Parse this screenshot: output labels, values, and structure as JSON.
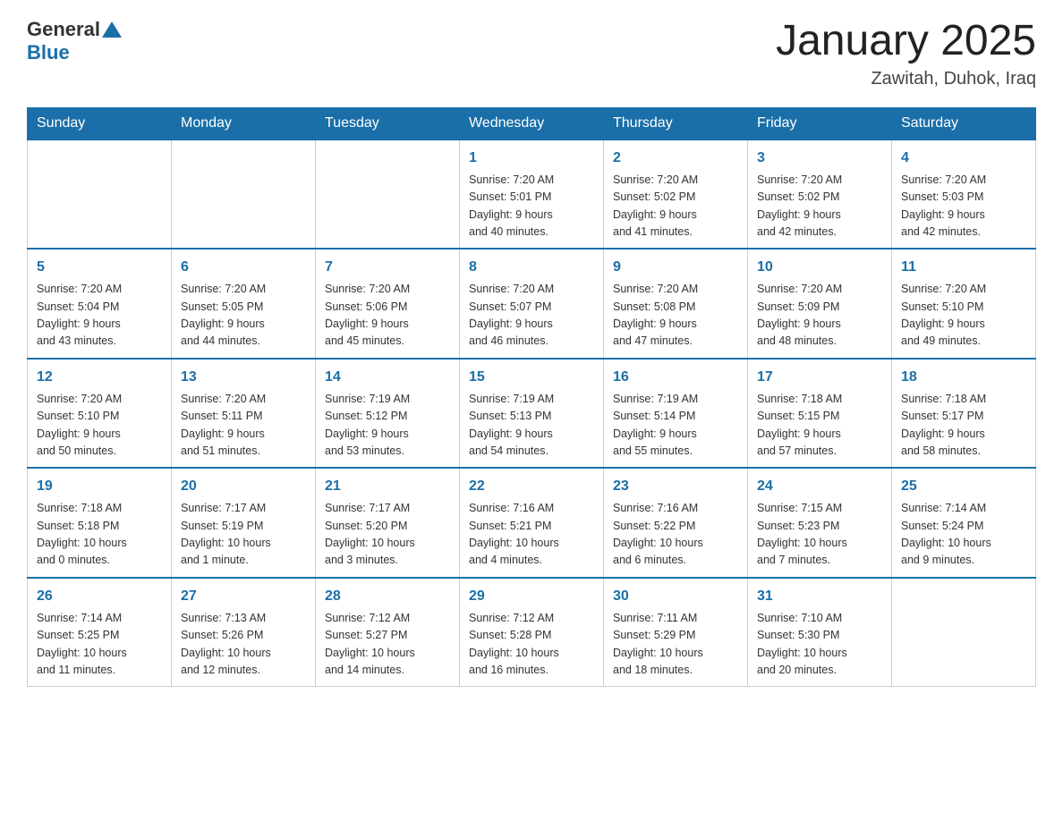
{
  "header": {
    "logo_general": "General",
    "logo_blue": "Blue",
    "month_title": "January 2025",
    "location": "Zawitah, Duhok, Iraq"
  },
  "days_of_week": [
    "Sunday",
    "Monday",
    "Tuesday",
    "Wednesday",
    "Thursday",
    "Friday",
    "Saturday"
  ],
  "weeks": [
    [
      {
        "day": "",
        "info": ""
      },
      {
        "day": "",
        "info": ""
      },
      {
        "day": "",
        "info": ""
      },
      {
        "day": "1",
        "info": "Sunrise: 7:20 AM\nSunset: 5:01 PM\nDaylight: 9 hours\nand 40 minutes."
      },
      {
        "day": "2",
        "info": "Sunrise: 7:20 AM\nSunset: 5:02 PM\nDaylight: 9 hours\nand 41 minutes."
      },
      {
        "day": "3",
        "info": "Sunrise: 7:20 AM\nSunset: 5:02 PM\nDaylight: 9 hours\nand 42 minutes."
      },
      {
        "day": "4",
        "info": "Sunrise: 7:20 AM\nSunset: 5:03 PM\nDaylight: 9 hours\nand 42 minutes."
      }
    ],
    [
      {
        "day": "5",
        "info": "Sunrise: 7:20 AM\nSunset: 5:04 PM\nDaylight: 9 hours\nand 43 minutes."
      },
      {
        "day": "6",
        "info": "Sunrise: 7:20 AM\nSunset: 5:05 PM\nDaylight: 9 hours\nand 44 minutes."
      },
      {
        "day": "7",
        "info": "Sunrise: 7:20 AM\nSunset: 5:06 PM\nDaylight: 9 hours\nand 45 minutes."
      },
      {
        "day": "8",
        "info": "Sunrise: 7:20 AM\nSunset: 5:07 PM\nDaylight: 9 hours\nand 46 minutes."
      },
      {
        "day": "9",
        "info": "Sunrise: 7:20 AM\nSunset: 5:08 PM\nDaylight: 9 hours\nand 47 minutes."
      },
      {
        "day": "10",
        "info": "Sunrise: 7:20 AM\nSunset: 5:09 PM\nDaylight: 9 hours\nand 48 minutes."
      },
      {
        "day": "11",
        "info": "Sunrise: 7:20 AM\nSunset: 5:10 PM\nDaylight: 9 hours\nand 49 minutes."
      }
    ],
    [
      {
        "day": "12",
        "info": "Sunrise: 7:20 AM\nSunset: 5:10 PM\nDaylight: 9 hours\nand 50 minutes."
      },
      {
        "day": "13",
        "info": "Sunrise: 7:20 AM\nSunset: 5:11 PM\nDaylight: 9 hours\nand 51 minutes."
      },
      {
        "day": "14",
        "info": "Sunrise: 7:19 AM\nSunset: 5:12 PM\nDaylight: 9 hours\nand 53 minutes."
      },
      {
        "day": "15",
        "info": "Sunrise: 7:19 AM\nSunset: 5:13 PM\nDaylight: 9 hours\nand 54 minutes."
      },
      {
        "day": "16",
        "info": "Sunrise: 7:19 AM\nSunset: 5:14 PM\nDaylight: 9 hours\nand 55 minutes."
      },
      {
        "day": "17",
        "info": "Sunrise: 7:18 AM\nSunset: 5:15 PM\nDaylight: 9 hours\nand 57 minutes."
      },
      {
        "day": "18",
        "info": "Sunrise: 7:18 AM\nSunset: 5:17 PM\nDaylight: 9 hours\nand 58 minutes."
      }
    ],
    [
      {
        "day": "19",
        "info": "Sunrise: 7:18 AM\nSunset: 5:18 PM\nDaylight: 10 hours\nand 0 minutes."
      },
      {
        "day": "20",
        "info": "Sunrise: 7:17 AM\nSunset: 5:19 PM\nDaylight: 10 hours\nand 1 minute."
      },
      {
        "day": "21",
        "info": "Sunrise: 7:17 AM\nSunset: 5:20 PM\nDaylight: 10 hours\nand 3 minutes."
      },
      {
        "day": "22",
        "info": "Sunrise: 7:16 AM\nSunset: 5:21 PM\nDaylight: 10 hours\nand 4 minutes."
      },
      {
        "day": "23",
        "info": "Sunrise: 7:16 AM\nSunset: 5:22 PM\nDaylight: 10 hours\nand 6 minutes."
      },
      {
        "day": "24",
        "info": "Sunrise: 7:15 AM\nSunset: 5:23 PM\nDaylight: 10 hours\nand 7 minutes."
      },
      {
        "day": "25",
        "info": "Sunrise: 7:14 AM\nSunset: 5:24 PM\nDaylight: 10 hours\nand 9 minutes."
      }
    ],
    [
      {
        "day": "26",
        "info": "Sunrise: 7:14 AM\nSunset: 5:25 PM\nDaylight: 10 hours\nand 11 minutes."
      },
      {
        "day": "27",
        "info": "Sunrise: 7:13 AM\nSunset: 5:26 PM\nDaylight: 10 hours\nand 12 minutes."
      },
      {
        "day": "28",
        "info": "Sunrise: 7:12 AM\nSunset: 5:27 PM\nDaylight: 10 hours\nand 14 minutes."
      },
      {
        "day": "29",
        "info": "Sunrise: 7:12 AM\nSunset: 5:28 PM\nDaylight: 10 hours\nand 16 minutes."
      },
      {
        "day": "30",
        "info": "Sunrise: 7:11 AM\nSunset: 5:29 PM\nDaylight: 10 hours\nand 18 minutes."
      },
      {
        "day": "31",
        "info": "Sunrise: 7:10 AM\nSunset: 5:30 PM\nDaylight: 10 hours\nand 20 minutes."
      },
      {
        "day": "",
        "info": ""
      }
    ]
  ]
}
